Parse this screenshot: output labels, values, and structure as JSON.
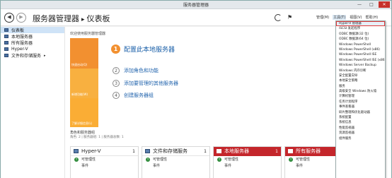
{
  "window": {
    "title": "服务器管理器",
    "buttons": [
      "—",
      "□",
      "✕"
    ]
  },
  "header": {
    "breadcrumb_app": "服务器管理器",
    "breadcrumb_sep": "▸",
    "breadcrumb_page": "仪表板",
    "back_icon": "back-icon",
    "forward_icon": "forward-icon"
  },
  "menu": {
    "manage": "管理(M)",
    "tools": "工具(T)",
    "view": "视图(V)",
    "help": "帮助(H)"
  },
  "sidebar": {
    "items": [
      {
        "label": "仪表板",
        "selected": true
      },
      {
        "label": "本地服务器"
      },
      {
        "label": "所有服务器"
      },
      {
        "label": "Hyper-V"
      },
      {
        "label": "文件和存储服务",
        "expand": "▸"
      }
    ]
  },
  "main": {
    "welcome": "欢迎使用服务器管理器",
    "tiles": [
      "快速启动(Q)",
      "新增功能(W)",
      "了解详细信息(L)"
    ],
    "step1": {
      "num": "1",
      "label": "配置此本地服务器"
    },
    "steps": [
      {
        "num": "2",
        "label": "添加角色和功能"
      },
      {
        "num": "3",
        "label": "添加要管理的其他服务器"
      },
      {
        "num": "4",
        "label": "创建服务器组"
      }
    ],
    "roles_head": "角色和服务器组",
    "roles_sub": "角色: 2 | 服务器组: 1 | 服务器总数: 1"
  },
  "cards": [
    {
      "title": "Hyper-V",
      "count": "1",
      "manageability": "可管理性",
      "events": "事件",
      "red": false
    },
    {
      "title": "文件和存储服务",
      "count": "1",
      "manageability": "可管理性",
      "events": "事件",
      "red": false
    },
    {
      "title": "本地服务器",
      "count": "1",
      "manageability": "可管理性",
      "events": "事件",
      "red": true
    },
    {
      "title": "所有服务器",
      "count": "1",
      "manageability": "可管理性",
      "events": "事件",
      "red": true
    }
  ],
  "tools_menu": [
    "Hyper-V 管理器",
    "iSCSI 发起程序",
    "ODBC 数据源(32 位)",
    "ODBC 数据源(64 位)",
    "Windows PowerShell",
    "Windows PowerShell (x86)",
    "Windows PowerShell ISE",
    "Windows PowerShell ISE (x86)",
    "Windows Server Backup",
    "Windows 内存诊断",
    "安全配置向导",
    "本地安全策略",
    "服务",
    "高级安全 Windows 防火墙",
    "计算机管理",
    "任务计划程序",
    "事件查看器",
    "碎片整理和优化驱动器",
    "系统配置",
    "系统信息",
    "性能监视器",
    "资源监视器",
    "组件服务"
  ],
  "colors": {
    "accent_orange": "#f29030",
    "alert_red": "#c4262b",
    "link_blue": "#2264ad"
  }
}
